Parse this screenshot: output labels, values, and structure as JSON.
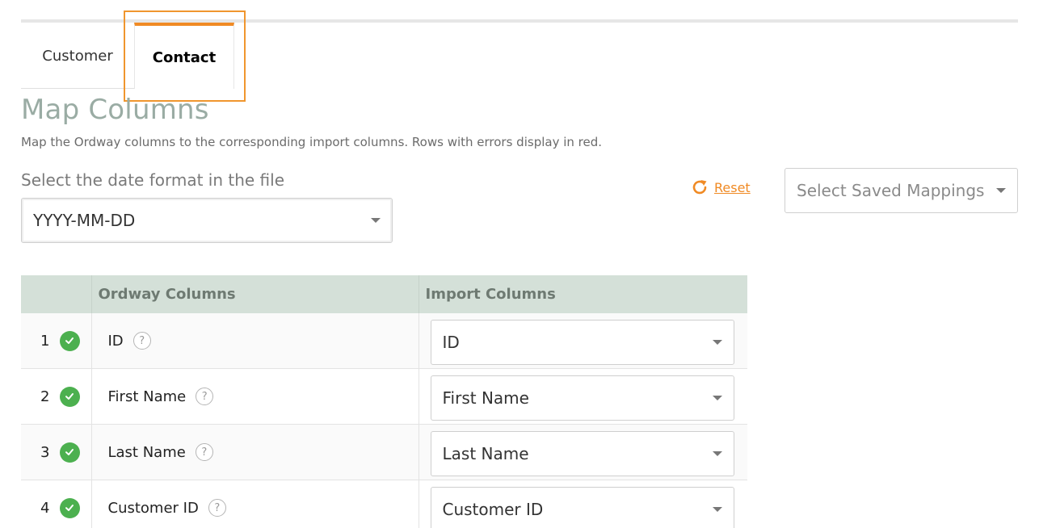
{
  "tabs": [
    {
      "label": "Customer",
      "active": false
    },
    {
      "label": "Contact",
      "active": true
    }
  ],
  "page": {
    "title": "Map Columns",
    "description": "Map the Ordway columns to the corresponding import columns. Rows with errors display in red."
  },
  "date_format": {
    "label": "Select the date format in the file",
    "selected": "YYYY-MM-DD"
  },
  "reset": {
    "label": "Reset",
    "icon": "refresh-icon"
  },
  "saved_mappings": {
    "placeholder": "Select Saved Mappings"
  },
  "table": {
    "headers": {
      "number": "",
      "ordway": "Ordway Columns",
      "import": "Import Columns"
    },
    "rows": [
      {
        "number": "1",
        "ordway": "ID",
        "help": "?",
        "import": "ID"
      },
      {
        "number": "2",
        "ordway": "First Name",
        "help": "?",
        "import": "First Name"
      },
      {
        "number": "3",
        "ordway": "Last Name",
        "help": "?",
        "import": "Last Name"
      },
      {
        "number": "4",
        "ordway": "Customer ID",
        "help": "?",
        "import": "Customer ID"
      }
    ]
  },
  "colors": {
    "accent": "#f08a24",
    "title": "#9aaca4",
    "table_header_bg": "#d4e0d8",
    "success": "#4cb04f"
  }
}
